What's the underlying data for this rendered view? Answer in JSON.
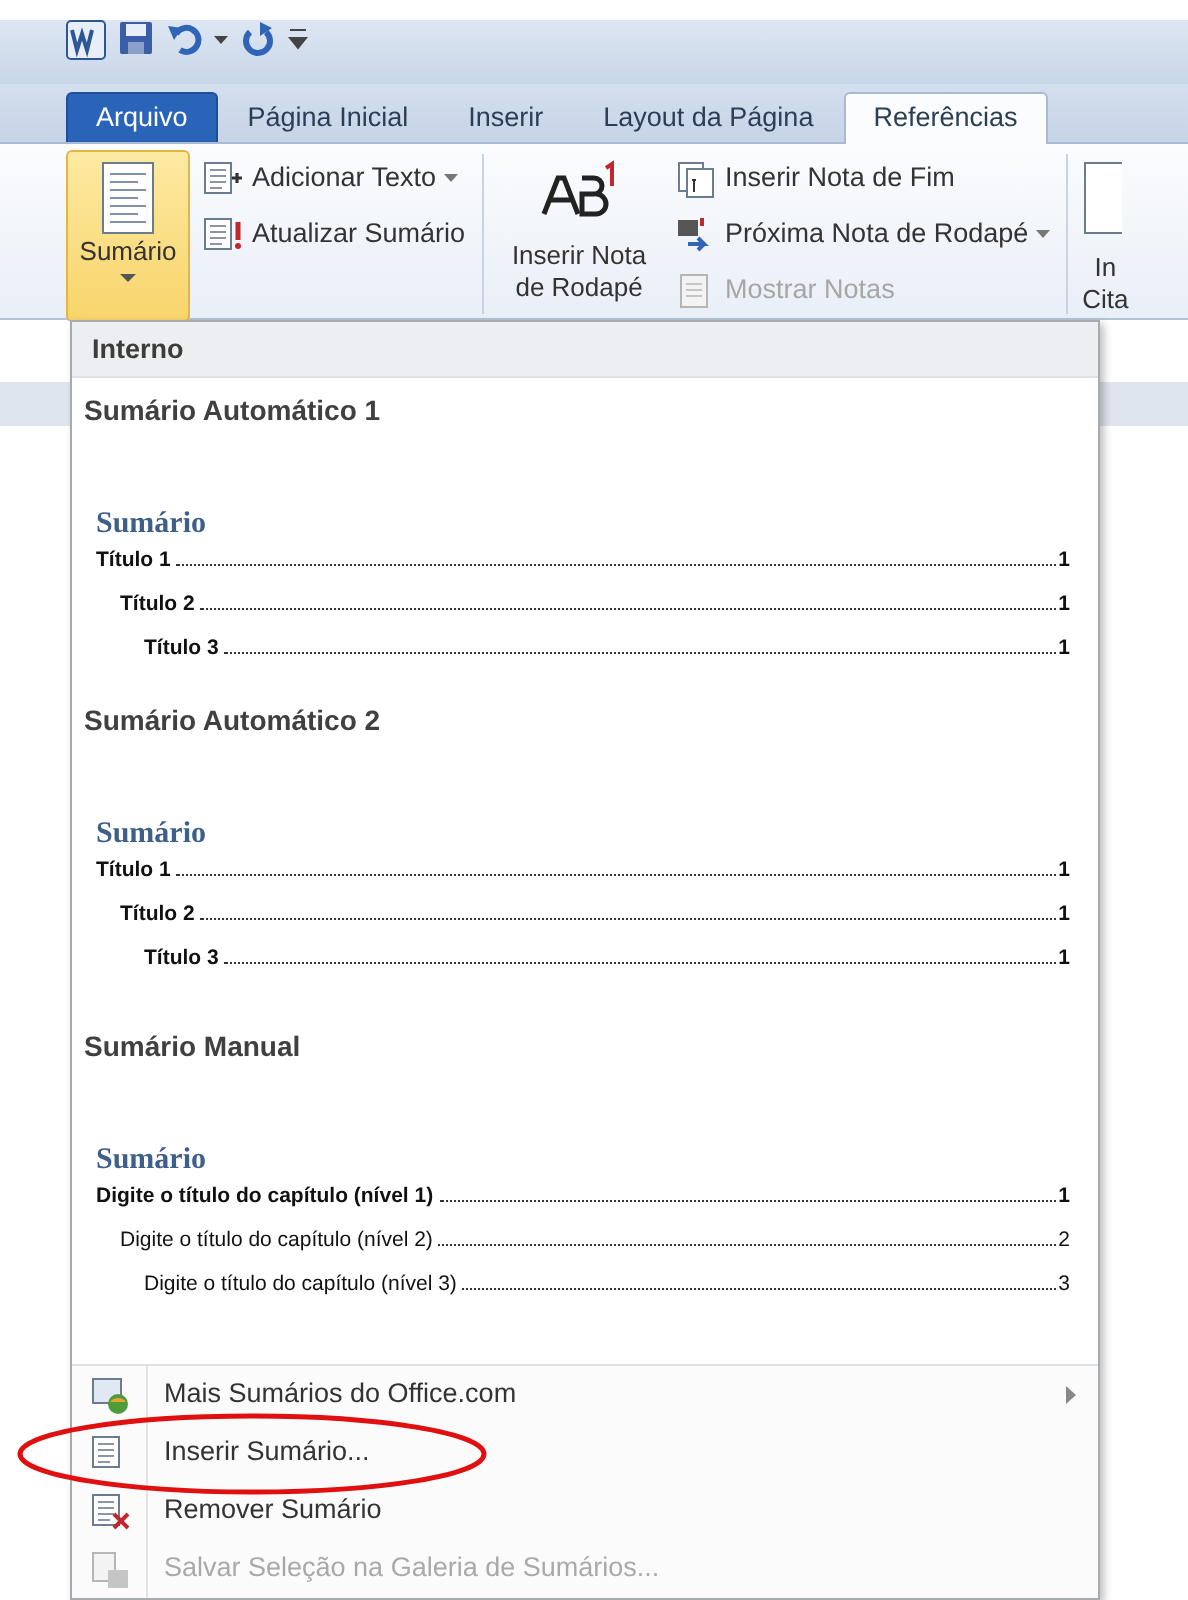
{
  "tabs": [
    {
      "label": "Arquivo",
      "kind": "file",
      "selected": false
    },
    {
      "label": "Página Inicial",
      "kind": "tab",
      "selected": false
    },
    {
      "label": "Inserir",
      "kind": "tab",
      "selected": false
    },
    {
      "label": "Layout da Página",
      "kind": "tab",
      "selected": false
    },
    {
      "label": "Referências",
      "kind": "tab",
      "selected": true
    }
  ],
  "ribbon": {
    "toc_button": {
      "label": "Sumário",
      "pressed": true
    },
    "toc_commands": [
      {
        "label": "Adicionar Texto",
        "kind": "add-text",
        "dropdown": true
      },
      {
        "label": "Atualizar Sumário",
        "kind": "update",
        "dropdown": false
      }
    ],
    "footnote_button": {
      "lines": [
        "Inserir Nota",
        "de Rodapé"
      ]
    },
    "footnote_commands": [
      {
        "label": "Inserir Nota de Fim",
        "kind": "endnote",
        "dropdown": false,
        "disabled": false
      },
      {
        "label": "Próxima Nota de Rodapé",
        "kind": "next",
        "dropdown": true,
        "disabled": false
      },
      {
        "label": "Mostrar Notas",
        "kind": "show",
        "dropdown": false,
        "disabled": true
      }
    ],
    "cut_button": {
      "lines": [
        "In",
        "Cita"
      ]
    }
  },
  "menu": {
    "header": "Interno",
    "galleries": [
      {
        "name": "Sumário Automático 1",
        "kind": "automatic",
        "preview": {
          "heading": "Sumário",
          "entries": [
            {
              "text": "Título 1",
              "page": "1",
              "children": [
                {
                  "text": "Título 2",
                  "page": "1",
                  "children": [
                    {
                      "text": "Título 3",
                      "page": "1"
                    }
                  ]
                }
              ]
            }
          ]
        }
      },
      {
        "name": "Sumário Automático 2",
        "kind": "automatic",
        "preview": {
          "heading": "Sumário",
          "entries": [
            {
              "text": "Título 1",
              "page": "1",
              "children": [
                {
                  "text": "Título 2",
                  "page": "1",
                  "children": [
                    {
                      "text": "Título 3",
                      "page": "1"
                    }
                  ]
                }
              ]
            }
          ]
        }
      },
      {
        "name": "Sumário Manual",
        "kind": "manual",
        "preview": {
          "heading": "Sumário",
          "entries": [
            {
              "text": "Digite o título do capítulo (nível 1)",
              "page": "1",
              "children": [
                {
                  "text": "Digite o título do capítulo (nível 2)",
                  "page": "2",
                  "children": [
                    {
                      "text": "Digite o título do capítulo (nível 3)",
                      "page": "3"
                    }
                  ]
                }
              ]
            }
          ]
        }
      }
    ],
    "commands": [
      {
        "label": "Mais Sumários do Office.com",
        "kind": "online",
        "submenu": true,
        "disabled": false,
        "circled": false
      },
      {
        "label": "Inserir Sumário...",
        "kind": "insert",
        "submenu": false,
        "disabled": false,
        "circled": true
      },
      {
        "label": "Remover Sumário",
        "kind": "remove",
        "submenu": false,
        "disabled": false,
        "circled": false
      },
      {
        "label": "Salvar Seleção na Galeria de Sumários...",
        "kind": "save",
        "submenu": false,
        "disabled": true,
        "circled": false
      }
    ]
  }
}
